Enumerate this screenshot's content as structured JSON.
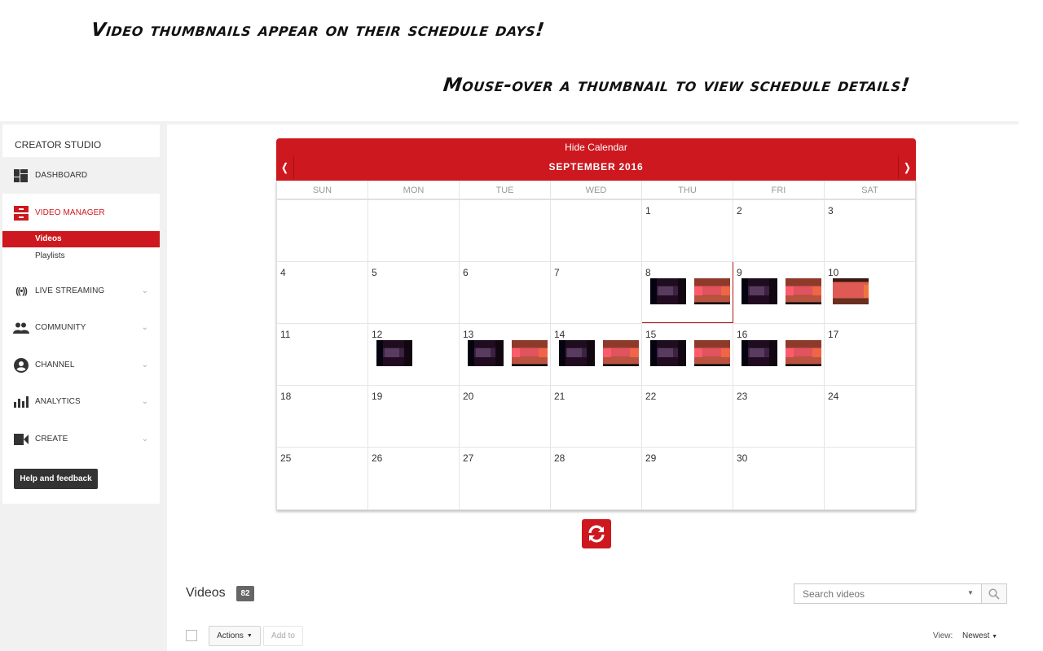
{
  "annotations": {
    "line1": "Video thumbnails appear on their schedule days!",
    "line2": "Mouse-over a thumbnail to view schedule details!"
  },
  "sidebar": {
    "title": "CREATOR STUDIO",
    "items": [
      {
        "label": "DASHBOARD",
        "icon": "dashboard-icon"
      },
      {
        "label": "VIDEO MANAGER",
        "icon": "video-manager-icon",
        "active": true
      },
      {
        "label": "LIVE STREAMING",
        "icon": "live-streaming-icon"
      },
      {
        "label": "COMMUNITY",
        "icon": "community-icon"
      },
      {
        "label": "CHANNEL",
        "icon": "channel-icon"
      },
      {
        "label": "ANALYTICS",
        "icon": "analytics-icon"
      },
      {
        "label": "CREATE",
        "icon": "create-icon"
      }
    ],
    "video_manager_sub": [
      {
        "label": "Videos",
        "active": true
      },
      {
        "label": "Playlists"
      }
    ],
    "help_label": "Help and feedback",
    "accent": "#cc181e"
  },
  "calendar": {
    "hide_label": "Hide Calendar",
    "month_label": "SEPTEMBER 2016",
    "prev_label": "❬",
    "next_label": "❭",
    "weekdays": [
      "SUN",
      "MON",
      "TUE",
      "WED",
      "THU",
      "FRI",
      "SAT"
    ],
    "today": 8,
    "weeks": [
      [
        "",
        "",
        "",
        "",
        "1",
        "2",
        "3"
      ],
      [
        "4",
        "5",
        "6",
        "7",
        "8",
        "9",
        "10"
      ],
      [
        "11",
        "12",
        "13",
        "14",
        "15",
        "16",
        "17"
      ],
      [
        "18",
        "19",
        "20",
        "21",
        "22",
        "23",
        "24"
      ],
      [
        "25",
        "26",
        "27",
        "28",
        "29",
        "30",
        ""
      ]
    ],
    "thumbnails": {
      "8": [
        "dark",
        "light"
      ],
      "9": [
        "dark",
        "light"
      ],
      "10": [
        "light2"
      ],
      "12": [
        "dark"
      ],
      "13": [
        "dark",
        "light"
      ],
      "14": [
        "dark",
        "light"
      ],
      "15": [
        "dark",
        "light"
      ],
      "16": [
        "dark",
        "light"
      ]
    }
  },
  "videos": {
    "title": "Videos",
    "count": "82",
    "search_placeholder": "Search videos",
    "actions_label": "Actions",
    "add_to_label": "Add to",
    "view_label": "View:",
    "view_value": "Newest"
  }
}
